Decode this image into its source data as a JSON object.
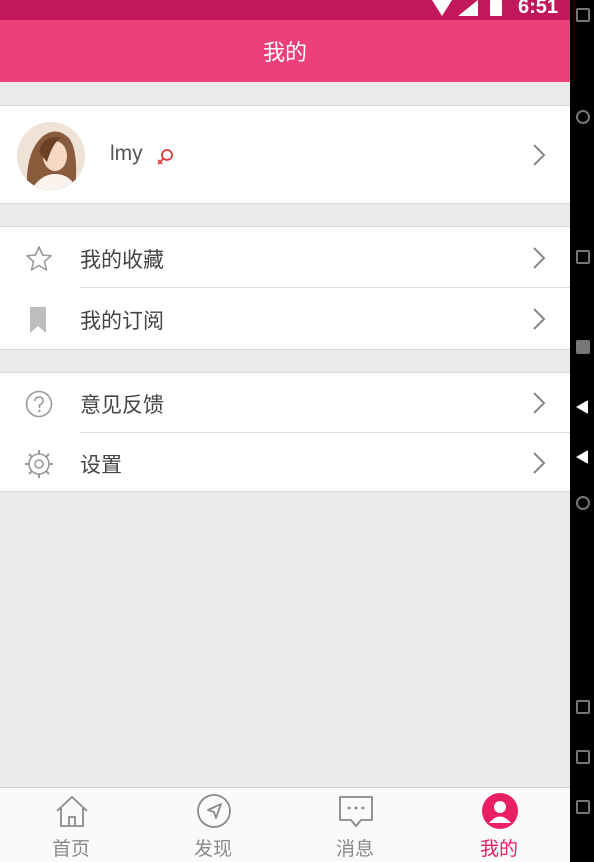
{
  "status_bar": {
    "time": "6:51"
  },
  "header": {
    "title": "我的"
  },
  "profile": {
    "name": "lmy"
  },
  "menu_group_1": [
    {
      "label": "我的收藏",
      "icon": "star-icon"
    },
    {
      "label": "我的订阅",
      "icon": "bookmark-icon"
    }
  ],
  "menu_group_2": [
    {
      "label": "意见反馈",
      "icon": "question-circle-icon"
    },
    {
      "label": "设置",
      "icon": "gear-icon"
    }
  ],
  "tabs": [
    {
      "label": "首页",
      "icon": "home-icon",
      "active": false
    },
    {
      "label": "发现",
      "icon": "compass-icon",
      "active": false
    },
    {
      "label": "消息",
      "icon": "message-icon",
      "active": false
    },
    {
      "label": "我的",
      "icon": "user-icon",
      "active": true
    }
  ],
  "colors": {
    "header": "#ec407a",
    "status_bar": "#c2185b",
    "accent": "#e91e63",
    "background": "#ebebeb"
  }
}
